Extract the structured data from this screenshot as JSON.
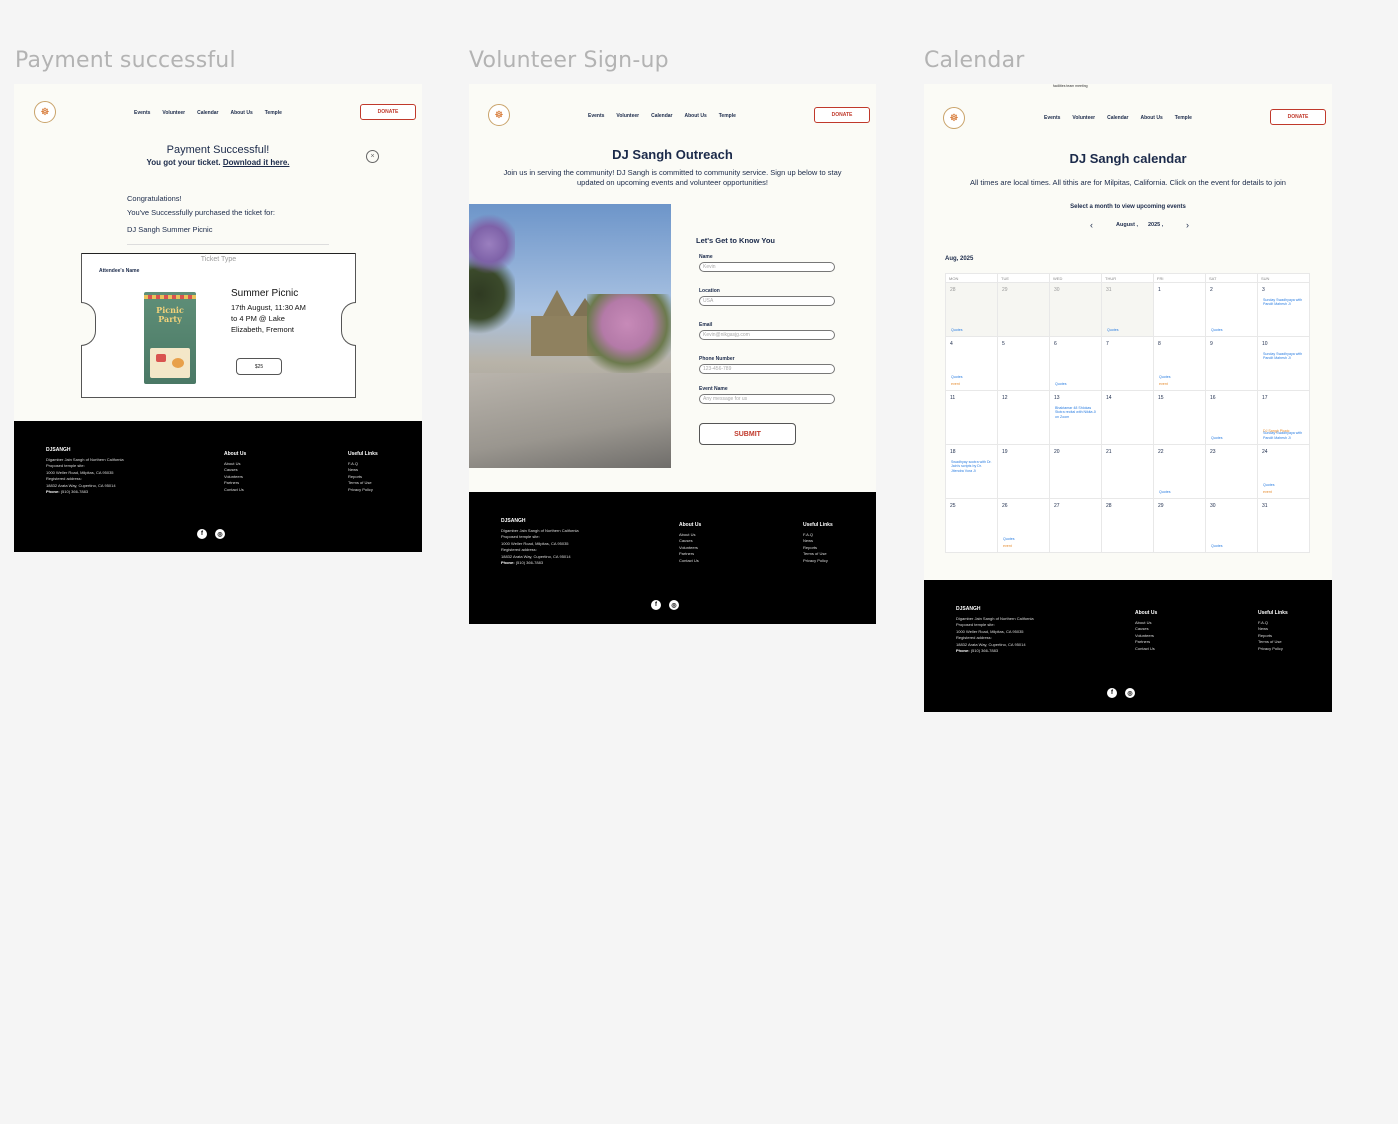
{
  "frames": {
    "payment": {
      "title": "Payment successful",
      "heading": "Payment Successful!",
      "subheading": "You got your ticket.",
      "download_link": "Download it here.",
      "congrats": "Congratulations!",
      "purchased": "You've Successfully purchased the ticket for:",
      "event_name": "DJ Sangh Summer Picnic",
      "ticket_type_label": "Ticket Type",
      "attendee_label": "Attendee's Name",
      "ticket_event_title": "Summer Picnic",
      "ticket_details": "17th August, 11:30 AM to 4 PM @ Lake Elizabeth, Fremont",
      "price": "$25",
      "poster_text": "Picnic Party"
    },
    "volunteer": {
      "title": "Volunteer Sign-up",
      "heading": "DJ Sangh Outreach",
      "intro": "Join us in serving the community! DJ Sangh is committed to community service. Sign up below to stay updated on upcoming events and volunteer opportunities!",
      "form_title": "Let's Get to Know You",
      "fields": [
        {
          "label": "Name",
          "placeholder": "Kevin"
        },
        {
          "label": "Location",
          "placeholder": "USA"
        },
        {
          "label": "Email",
          "placeholder": "Kevin@nikgasjg.com"
        },
        {
          "label": "Phone Number",
          "placeholder": "123-456-789"
        },
        {
          "label": "Event Name",
          "placeholder": "Any message for us"
        }
      ],
      "submit": "SUBMIT"
    },
    "calendar": {
      "title": "Calendar",
      "top_note": "facilities team meeting",
      "heading": "DJ Sangh calendar",
      "intro": "All times are local times. All tithis are for Milpitas, California. Click on the event for details to join",
      "select_prompt": "Select a month to view upcoming events",
      "month": "August ,",
      "year": "2025 ,",
      "prev": "‹",
      "next": "›",
      "month_label": "Aug, 2025",
      "weekdays": [
        "MON",
        "TUE",
        "WED",
        "THUR",
        "FRI",
        "SAT",
        "SUN"
      ],
      "weeks": [
        [
          {
            "day": "28",
            "muted": true,
            "events": [
              {
                "text": "Quotes",
                "color": "blue"
              }
            ]
          },
          {
            "day": "29",
            "muted": true,
            "events": []
          },
          {
            "day": "30",
            "muted": true,
            "events": []
          },
          {
            "day": "31",
            "muted": true,
            "events": [
              {
                "text": "Quotes",
                "color": "blue"
              }
            ]
          },
          {
            "day": "1",
            "muted": false,
            "events": []
          },
          {
            "day": "2",
            "muted": false,
            "events": [
              {
                "text": "Quotes",
                "color": "blue"
              }
            ]
          },
          {
            "day": "3",
            "muted": false,
            "events": [
              {
                "text": "Sunday Swadhyaya with Pandit Mahesh Ji",
                "color": "blue"
              }
            ]
          }
        ],
        [
          {
            "day": "4",
            "muted": false,
            "events": [
              {
                "text": "Quotes",
                "color": "blue"
              },
              {
                "text": "event",
                "color": "orange"
              }
            ]
          },
          {
            "day": "5",
            "muted": false,
            "events": []
          },
          {
            "day": "6",
            "muted": false,
            "events": [
              {
                "text": "Quotes",
                "color": "blue"
              }
            ]
          },
          {
            "day": "7",
            "muted": false,
            "events": []
          },
          {
            "day": "8",
            "muted": false,
            "events": [
              {
                "text": "Quotes",
                "color": "blue"
              },
              {
                "text": "event",
                "color": "orange"
              }
            ]
          },
          {
            "day": "9",
            "muted": false,
            "events": []
          },
          {
            "day": "10",
            "muted": false,
            "events": [
              {
                "text": "Sunday Swadhyaya with Pandit Mahesh Ji",
                "color": "blue"
              }
            ]
          }
        ],
        [
          {
            "day": "11",
            "muted": false,
            "events": []
          },
          {
            "day": "12",
            "muted": false,
            "events": []
          },
          {
            "day": "13",
            "muted": false,
            "events": [
              {
                "text": "Bhaktamar 48 Shlokas Stotra recital with Nikita Ji on Zoom",
                "color": "blue"
              }
            ]
          },
          {
            "day": "14",
            "muted": false,
            "events": []
          },
          {
            "day": "15",
            "muted": false,
            "events": []
          },
          {
            "day": "16",
            "muted": false,
            "events": [
              {
                "text": "Quotes",
                "color": "blue"
              }
            ]
          },
          {
            "day": "17",
            "muted": false,
            "events": [
              {
                "text": "DJ Sangh Picnic",
                "color": "orange"
              },
              {
                "text": "Sunday Swadhyaya with Pandit Mahesh Ji",
                "color": "blue"
              }
            ]
          }
        ],
        [
          {
            "day": "18",
            "muted": false,
            "events": [
              {
                "text": "Swadhyay sootra with Dr. Jain's scripts by Dr. Jitendra Vora Ji",
                "color": "blue"
              }
            ]
          },
          {
            "day": "19",
            "muted": false,
            "events": []
          },
          {
            "day": "20",
            "muted": false,
            "events": []
          },
          {
            "day": "21",
            "muted": false,
            "events": []
          },
          {
            "day": "22",
            "muted": false,
            "events": [
              {
                "text": "Quotes",
                "color": "blue"
              }
            ]
          },
          {
            "day": "23",
            "muted": false,
            "events": []
          },
          {
            "day": "24",
            "muted": false,
            "events": [
              {
                "text": "Quotes",
                "color": "blue"
              },
              {
                "text": "event",
                "color": "orange"
              }
            ]
          }
        ],
        [
          {
            "day": "25",
            "muted": false,
            "events": []
          },
          {
            "day": "26",
            "muted": false,
            "events": [
              {
                "text": "Quotes",
                "color": "blue"
              },
              {
                "text": "event",
                "color": "orange"
              }
            ]
          },
          {
            "day": "27",
            "muted": false,
            "events": []
          },
          {
            "day": "28",
            "muted": false,
            "events": []
          },
          {
            "day": "29",
            "muted": false,
            "events": []
          },
          {
            "day": "30",
            "muted": false,
            "events": [
              {
                "text": "Quotes",
                "color": "blue"
              }
            ]
          },
          {
            "day": "31",
            "muted": false,
            "events": []
          }
        ]
      ]
    }
  },
  "nav": {
    "links": [
      "Events",
      "Volunteer",
      "Calendar",
      "About Us",
      "Temple"
    ],
    "donate": "DONATE"
  },
  "footer": {
    "brand": "DJSANGH",
    "org": "Digamber Jain Sangh of Northern California",
    "proposed_label": "Proposed temple site:",
    "proposed_address": "1000 Weller Road, Milpitas, CA 95035",
    "registered_label": "Registered address:",
    "registered_address": "18832 Arata Way, Cupertino, CA 95014",
    "phone_label": "Phone:",
    "phone": "(510) 366-7883",
    "about_title": "About Us",
    "about_links": [
      "About Us",
      "Causes",
      "Volunteers",
      "Partners",
      "Contact Us"
    ],
    "useful_title": "Useful Links",
    "useful_links": [
      "F.A.Q",
      "News",
      "Reports",
      "Terms of Use",
      "Privacy Policy"
    ]
  },
  "colors": {
    "page_bg": "#f5f5f5",
    "frame_bg": "#fbfbf6",
    "navy": "#1b2a4a",
    "accent_red": "#c0392b",
    "event_blue": "#2a7de1",
    "event_orange": "#e58a2b",
    "footer_bg": "#000000"
  },
  "icons": [
    "close-icon",
    "facebook-icon",
    "instagram-icon",
    "chevron-left-icon",
    "chevron-right-icon",
    "logo-icon"
  ]
}
